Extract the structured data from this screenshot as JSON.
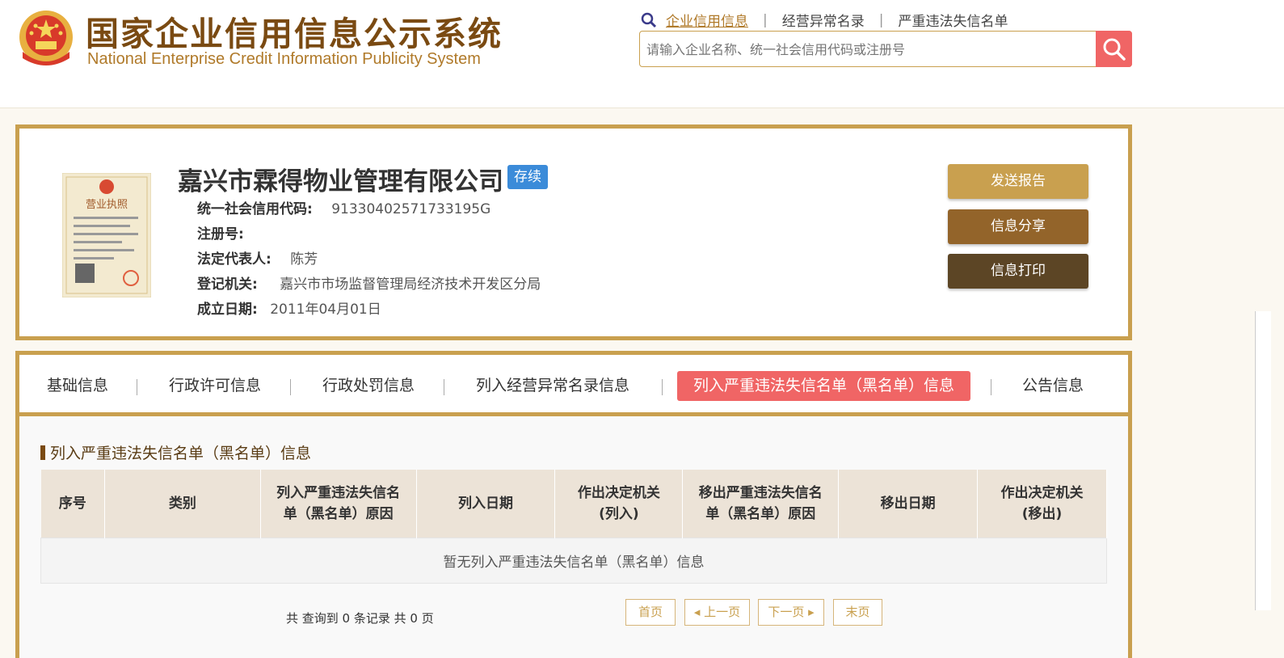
{
  "header": {
    "title_cn": "国家企业信用信息公示系统",
    "title_en": "National Enterprise Credit Information Publicity System",
    "links": [
      "企业信用信息",
      "经营异常名录",
      "严重违法失信名单"
    ],
    "search_placeholder": "请输入企业名称、统一社会信用代码或注册号"
  },
  "company": {
    "name": "嘉兴市霖得物业管理有限公司",
    "status": "存续",
    "license_title": "营业执照",
    "fields": [
      {
        "label": "统一社会信用代码:",
        "value": "91330402571733195G"
      },
      {
        "label": "注册号:",
        "value": ""
      },
      {
        "label": "法定代表人:",
        "value": "陈芳"
      },
      {
        "label": "登记机关:",
        "value": "嘉兴市市场监督管理局经济技术开发区分局"
      },
      {
        "label": "成立日期:",
        "value": "2011年04月01日"
      }
    ],
    "actions": [
      "发送报告",
      "信息分享",
      "信息打印"
    ]
  },
  "tabs": [
    "基础信息",
    "行政许可信息",
    "行政处罚信息",
    "列入经营异常名录信息",
    "列入严重违法失信名单（黑名单）信息",
    "公告信息"
  ],
  "section": {
    "title": "列入严重违法失信名单（黑名单）信息",
    "columns": [
      "序号",
      "类别",
      "列入严重违法失信名单（黑名单）原因",
      "列入日期",
      "作出决定机关(列入)",
      "移出严重违法失信名单（黑名单）原因",
      "移出日期",
      "作出决定机关(移出)"
    ],
    "empty_text": "暂无列入严重违法失信名单（黑名单）信息",
    "record_count": "共 查询到 0 条记录 共 0 页",
    "pagination": [
      "首页",
      "上一页",
      "下一页",
      "末页"
    ]
  },
  "colors": {
    "gold": "#c9a04f",
    "brown": "#7a4a12",
    "red": "#f06565",
    "blue": "#3b8bd9"
  }
}
